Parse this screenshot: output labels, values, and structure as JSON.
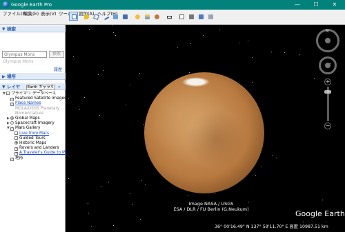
{
  "window": {
    "title": "Google Earth Pro",
    "minimize": "—",
    "maximize": "☐",
    "close": "✕"
  },
  "menu": [
    "ファイル(F)",
    "編集(E)",
    "表示(V)",
    "ツール(T)",
    "追加(A)",
    "ヘルプ(H)"
  ],
  "toolbar": {
    "tools": [
      "sidebar-toggle",
      "placemark",
      "polygon",
      "path",
      "image-overlay",
      "record-tour",
      "historical-imagery",
      "sunlight",
      "planets",
      "ruler",
      "email",
      "print",
      "save-image",
      "view-in-maps"
    ],
    "active": "sidebar-toggle"
  },
  "search": {
    "section_label": "検索",
    "placeholder": "Olympus Mons",
    "button": "検索",
    "history_link": "履歴"
  },
  "places": {
    "section_label": "場所"
  },
  "layers": {
    "section_label": "レイヤ",
    "gallery_button": "Earth ギャラリー",
    "gallery_arrow": "»",
    "items": [
      {
        "label": "プライマリ データベース",
        "indent": 0,
        "expander": "▼",
        "control": "checkbox",
        "checked": false,
        "style": "normal"
      },
      {
        "label": "Featured Satellite Images",
        "indent": 1,
        "expander": "",
        "control": "checkbox",
        "checked": true,
        "style": "normal"
      },
      {
        "label": "Place Names",
        "indent": 1,
        "expander": "",
        "control": "checkbox",
        "checked": true,
        "style": "link"
      },
      {
        "label": "MOLA/USGS Planetary",
        "indent": 1,
        "expander": "",
        "control": "none",
        "checked": false,
        "style": "gray"
      },
      {
        "label": "Nomenclature",
        "indent": 1,
        "expander": "",
        "control": "none",
        "checked": false,
        "style": "gray"
      },
      {
        "label": "Global Maps",
        "indent": 1,
        "expander": "▶",
        "control": "radio",
        "checked": true,
        "style": "normal"
      },
      {
        "label": "Spacecraft Imagery",
        "indent": 1,
        "expander": "▶",
        "control": "radio",
        "checked": false,
        "style": "normal"
      },
      {
        "label": "Mars Gallery",
        "indent": 1,
        "expander": "▼",
        "control": "checkbox",
        "checked": true,
        "style": "normal"
      },
      {
        "label": "Live from Mars",
        "indent": 2,
        "expander": "",
        "control": "checkbox",
        "checked": false,
        "style": "link"
      },
      {
        "label": "Guided Tours",
        "indent": 2,
        "expander": "",
        "control": "checkbox",
        "checked": false,
        "style": "normal"
      },
      {
        "label": "Historic Maps",
        "indent": 2,
        "expander": "",
        "control": "radio",
        "checked": true,
        "style": "normal"
      },
      {
        "label": "Rovers and Landers",
        "indent": 2,
        "expander": "",
        "control": "checkbox",
        "checked": true,
        "style": "normal"
      },
      {
        "label": "A Traveler's Guide to Mars",
        "indent": 2,
        "expander": "",
        "control": "checkbox",
        "checked": true,
        "style": "link"
      },
      {
        "label": "地形",
        "indent": 1,
        "expander": "",
        "control": "checkbox",
        "checked": true,
        "style": "normal"
      }
    ]
  },
  "viewport": {
    "attribution_line1": "Image NASA / USGS",
    "attribution_line2": "ESA / DLR / FU Berlin (G.Neukum)",
    "brand": "Google Earth",
    "status": "36° 00'16.49\" N   137° 59'11.70\" E   高度 10987.51 km",
    "nav_north": "N",
    "zoom_in": "+",
    "zoom_out": "−",
    "zoom_level_fraction": 0.12
  },
  "colors": {
    "titlebar": "#02827a",
    "panel_header": "#e1ebf7",
    "link": "#1b47c8"
  }
}
